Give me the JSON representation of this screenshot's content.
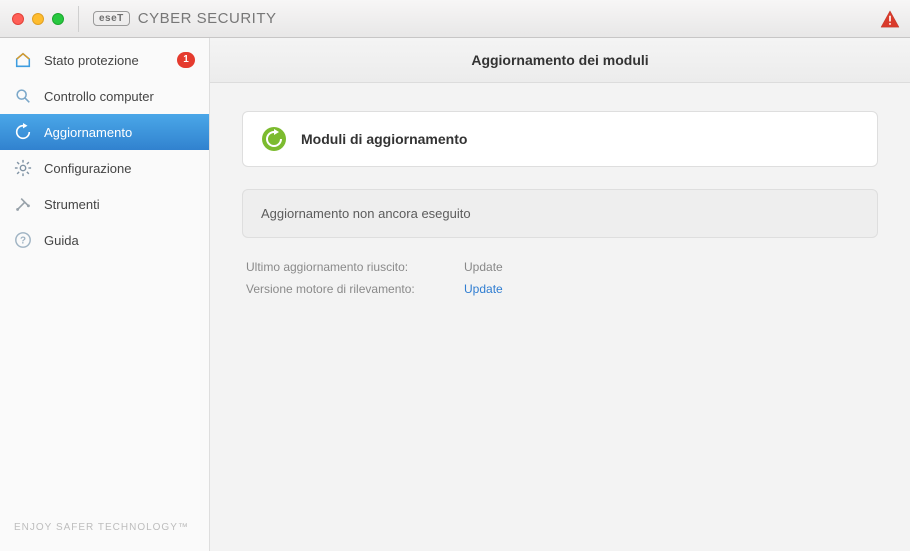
{
  "app": {
    "brand_pill": "eseT",
    "brand_name": "CYBER SECURITY",
    "footer": "ENJOY SAFER TECHNOLOGY™"
  },
  "sidebar": {
    "items": [
      {
        "label": "Stato protezione",
        "badge": "1",
        "icon": "home-icon"
      },
      {
        "label": "Controllo computer",
        "icon": "scan-icon"
      },
      {
        "label": "Aggiornamento",
        "icon": "refresh-icon",
        "active": true
      },
      {
        "label": "Configurazione",
        "icon": "gear-icon"
      },
      {
        "label": "Strumenti",
        "icon": "tools-icon"
      },
      {
        "label": "Guida",
        "icon": "help-icon"
      }
    ]
  },
  "page": {
    "title": "Aggiornamento dei moduli",
    "card_title": "Moduli di aggiornamento",
    "status_text": "Aggiornamento non ancora eseguito",
    "last_update_label": "Ultimo aggiornamento riuscito:",
    "last_update_value": "Update",
    "engine_label": "Versione motore di rilevamento:",
    "engine_value": "Update"
  }
}
